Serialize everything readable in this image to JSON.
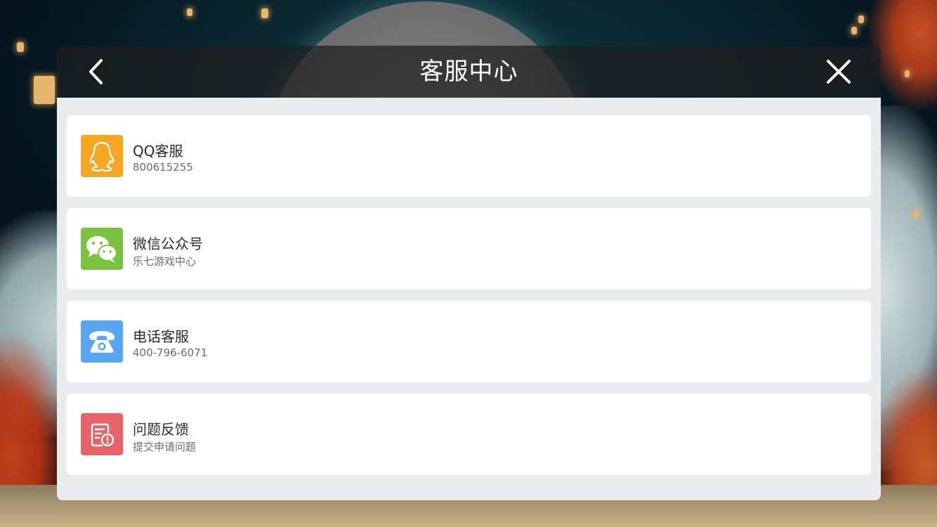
{
  "dialog": {
    "title": "客服中心"
  },
  "colors": {
    "header_bg": "#1e1e1e",
    "body_bg": "#e9eced",
    "qq": "#f5a623",
    "wechat": "#7cc241",
    "phone": "#58a6f2",
    "feedback": "#e8626a"
  },
  "items": [
    {
      "icon": "qq-penguin-icon",
      "title": "QQ客服",
      "subtitle": "800615255"
    },
    {
      "icon": "wechat-icon",
      "title": "微信公众号",
      "subtitle": "乐七游戏中心"
    },
    {
      "icon": "telephone-icon",
      "title": "电话客服",
      "subtitle": "400-796-6071"
    },
    {
      "icon": "feedback-document-icon",
      "title": "问题反馈",
      "subtitle": "提交申请问题"
    }
  ]
}
